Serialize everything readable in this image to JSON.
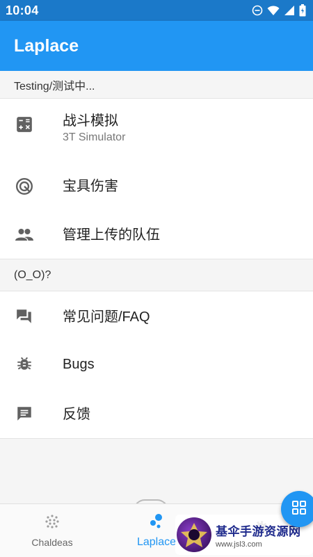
{
  "status_bar": {
    "time": "10:04",
    "icons": [
      "do-not-disturb-icon",
      "wifi-icon",
      "signal-icon",
      "battery-icon"
    ]
  },
  "app_bar": {
    "title": "Laplace"
  },
  "sections": [
    {
      "header": "Testing/测试中...",
      "items": [
        {
          "icon": "calculator-icon",
          "label": "战斗模拟",
          "sublabel": "3T Simulator"
        },
        {
          "icon": "target-icon",
          "label": "宝具伤害"
        },
        {
          "icon": "people-icon",
          "label": "管理上传的队伍"
        }
      ]
    },
    {
      "header": "(O_O)?",
      "items": [
        {
          "icon": "forum-icon",
          "label": "常见问题/FAQ"
        },
        {
          "icon": "bug-icon",
          "label": "Bugs"
        },
        {
          "icon": "feedback-icon",
          "label": "反馈"
        }
      ]
    }
  ],
  "bottom_nav": {
    "items": [
      {
        "icon": "dots-grid-icon",
        "label": "Chaldeas",
        "active": false
      },
      {
        "icon": "bubbles-icon",
        "label": "Laplace",
        "active": true
      },
      {
        "icon": "settings-icon",
        "label": "",
        "active": false
      }
    ]
  },
  "fab": {
    "icon": "apps-grid-icon"
  },
  "watermark": {
    "title": "基伞手游资源网",
    "url": "www.jsl3.com"
  },
  "colors": {
    "primary": "#2196f3",
    "status_bar": "#1b79c9",
    "background": "#f5f5f5",
    "icon": "#616161"
  }
}
